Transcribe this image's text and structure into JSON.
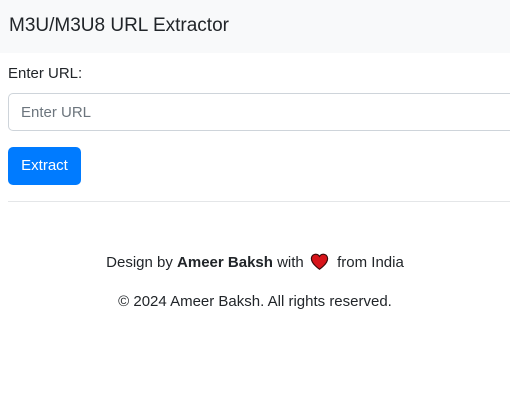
{
  "navbar": {
    "brand": "M3U/M3U8 URL Extractor"
  },
  "form": {
    "url_label": "Enter URL:",
    "url_placeholder": "Enter URL",
    "url_value": "",
    "extract_label": "Extract"
  },
  "footer": {
    "design_prefix": "Design by",
    "author": "Ameer Baksh",
    "with_text": "with",
    "heart_icon": "heart-icon",
    "from_text": "from India",
    "copyright": "© 2024 Ameer Baksh. All rights reserved."
  },
  "colors": {
    "navbar_bg": "#f8f9fa",
    "primary": "#007bff",
    "heart": "#d7141a"
  }
}
